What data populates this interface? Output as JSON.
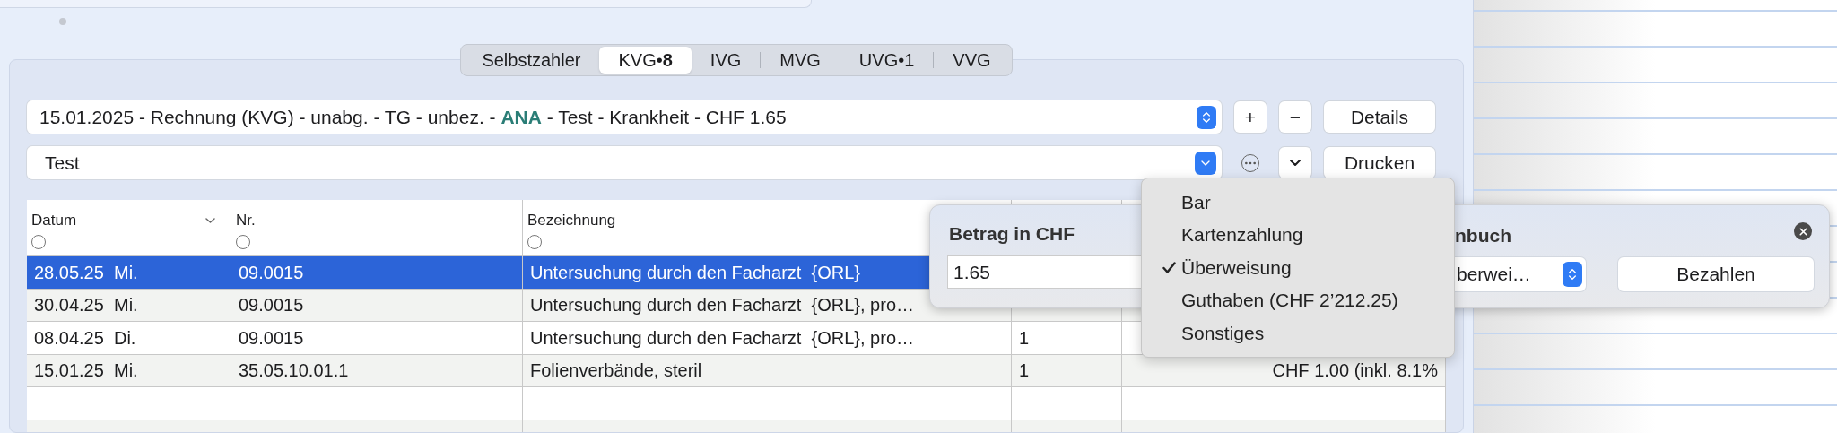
{
  "tabs": [
    {
      "label": "Selbstzahler",
      "selected": false
    },
    {
      "label": "KVG•**8**",
      "selected": true
    },
    {
      "label": "IVG",
      "selected": false
    },
    {
      "label": "MVG",
      "selected": false
    },
    {
      "label": "UVG•1",
      "selected": false
    },
    {
      "label": "VVG",
      "selected": false
    }
  ],
  "invoice_select": {
    "value": "15.01.2025 - Rechnung (KVG) - unabg. - TG - unbez. - **ANA** - Test - Krankheit - CHF 1.65"
  },
  "invoice_buttons": [
    "+",
    "−",
    "Details"
  ],
  "template_select": {
    "value": "Test"
  },
  "print_button": "Drucken",
  "table": {
    "columns": [
      {
        "label": "Datum",
        "sorted": true,
        "filter_checked": false
      },
      {
        "label": "Nr.",
        "sorted": false,
        "filter_checked": false
      },
      {
        "label": "Bezeichnung",
        "sorted": false,
        "filter_checked": false
      }
    ],
    "rows": [
      {
        "selected": true,
        "cells": [
          "28.05.25  Mi.",
          "09.0015",
          "Untersuchung durch den Facharzt  {ORL}"
        ]
      },
      {
        "selected": false,
        "cells": [
          "30.04.25  Mi.",
          "09.0015",
          "Untersuchung durch den Facharzt  {ORL}, pro…"
        ]
      },
      {
        "selected": false,
        "cells": [
          "08.04.25  Di.",
          "09.0015",
          "Untersuchung durch den Facharzt  {ORL}, pro…",
          "1"
        ]
      },
      {
        "selected": false,
        "cells": [
          "15.01.25  Mi.",
          "35.05.10.01.1",
          "Folienverbände, steril",
          "1",
          "CHF 1.00 (inkl. 8.1%"
        ]
      }
    ]
  },
  "payment_popover": {
    "title": "Betrag in CHF",
    "amount": "1.65",
    "method_label": "nbuch",
    "method_value": "berwei…",
    "pay_button": "Bezahlen"
  },
  "payment_menu": {
    "items": [
      {
        "label": "Bar",
        "selected": false
      },
      {
        "label": "Kartenzahlung",
        "selected": false
      },
      {
        "label": "Überweisung",
        "selected": true
      },
      {
        "label": "Guthaben (CHF 2’212.25)",
        "selected": false
      },
      {
        "label": "Sonstiges",
        "selected": false
      }
    ]
  }
}
